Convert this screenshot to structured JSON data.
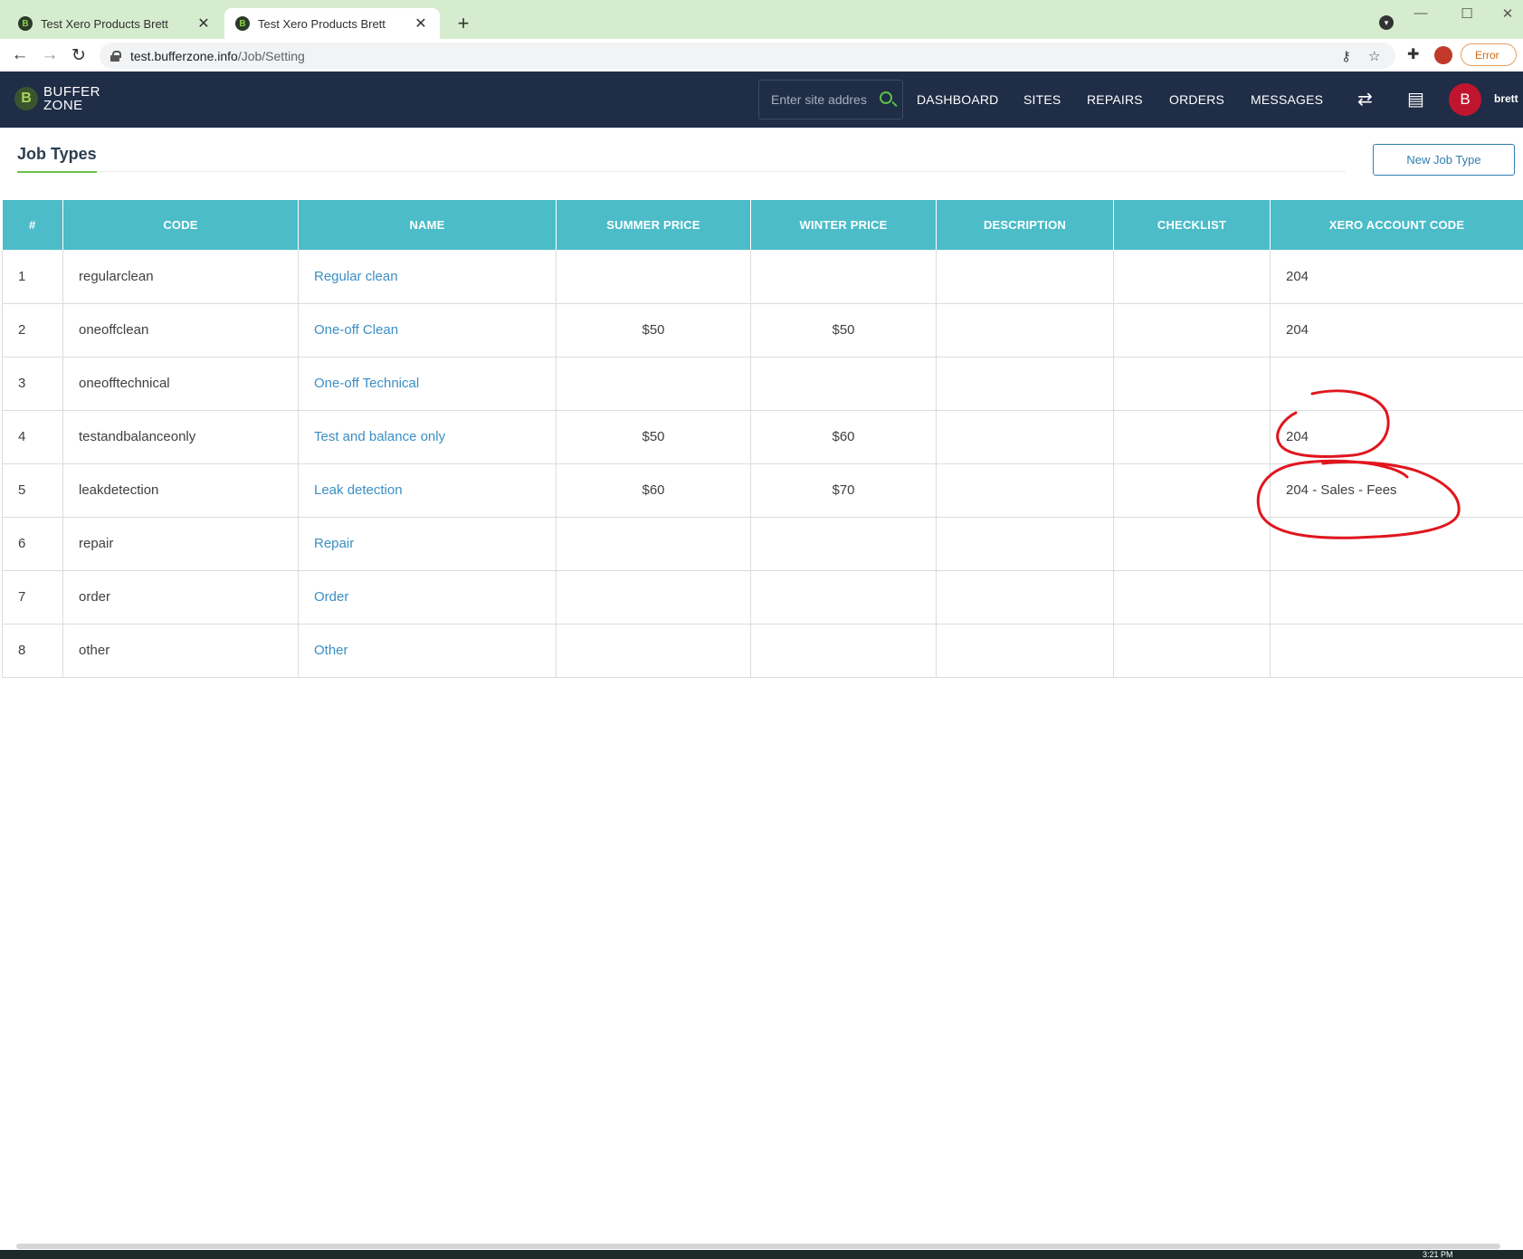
{
  "browser": {
    "tabs": [
      {
        "title": "Test Xero Products Brett",
        "favicon": "B"
      },
      {
        "title": "Test Xero Products Brett",
        "favicon": "B"
      }
    ],
    "url_host": "test.bufferzone.info",
    "url_path": "/Job/Setting",
    "error_label": "Error"
  },
  "header": {
    "logo_mark": "B",
    "logo_line1": "BUFFER",
    "logo_line2": "ZONE",
    "search_placeholder": "Enter site address",
    "nav": [
      "DASHBOARD",
      "SITES",
      "REPAIRS",
      "ORDERS",
      "MESSAGES"
    ],
    "avatar_initial": "B",
    "username": "brett",
    "bg_color": "#1f2d46"
  },
  "page": {
    "title": "Job Types",
    "new_button": "New Job Type"
  },
  "table": {
    "columns": [
      "#",
      "CODE",
      "NAME",
      "SUMMER PRICE",
      "WINTER PRICE",
      "DESCRIPTION",
      "CHECKLIST",
      "XERO ACCOUNT CODE"
    ],
    "header_color": "#4bbcc8",
    "link_color": "#3b8fc4",
    "rows": [
      {
        "num": "1",
        "code": "regularclean",
        "name": "Regular clean",
        "summer": "",
        "winter": "",
        "description": "",
        "checklist": "",
        "xero": "204"
      },
      {
        "num": "2",
        "code": "oneoffclean",
        "name": "One-off Clean",
        "summer": "$50",
        "winter": "$50",
        "description": "",
        "checklist": "",
        "xero": "204"
      },
      {
        "num": "3",
        "code": "oneofftechnical",
        "name": "One-off Technical",
        "summer": "",
        "winter": "",
        "description": "",
        "checklist": "",
        "xero": ""
      },
      {
        "num": "4",
        "code": "testandbalanceonly",
        "name": "Test and balance only",
        "summer": "$50",
        "winter": "$60",
        "description": "",
        "checklist": "",
        "xero": "204"
      },
      {
        "num": "5",
        "code": "leakdetection",
        "name": "Leak detection",
        "summer": "$60",
        "winter": "$70",
        "description": "",
        "checklist": "",
        "xero": "204 - Sales - Fees"
      },
      {
        "num": "6",
        "code": "repair",
        "name": "Repair",
        "summer": "",
        "winter": "",
        "description": "",
        "checklist": "",
        "xero": ""
      },
      {
        "num": "7",
        "code": "order",
        "name": "Order",
        "summer": "",
        "winter": "",
        "description": "",
        "checklist": "",
        "xero": ""
      },
      {
        "num": "8",
        "code": "other",
        "name": "Other",
        "summer": "",
        "winter": "",
        "description": "",
        "checklist": "",
        "xero": ""
      }
    ]
  },
  "annotation_color": "#e0161e",
  "taskbar": {
    "clock": "3:21 PM"
  }
}
